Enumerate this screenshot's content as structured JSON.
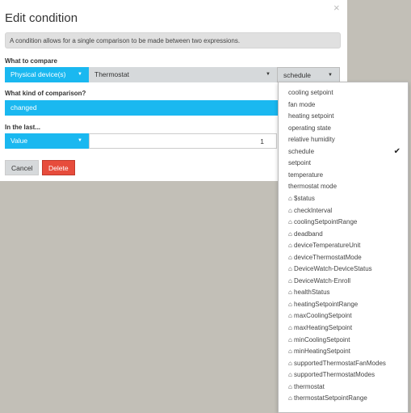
{
  "dialog": {
    "title": "Edit condition",
    "close_icon": "×",
    "info": "A condition allows for a single comparison to be made between two expressions.",
    "compare_label": "What to compare",
    "source": "Physical device(s)",
    "device": "Thermostat",
    "attribute": "schedule",
    "comparison_label": "What kind of comparison?",
    "comparison": "changed",
    "last_label": "In the last...",
    "last_type": "Value",
    "last_value": "1",
    "cancel": "Cancel",
    "delete": "Delete"
  },
  "colors": {
    "accent": "#1ab8f0",
    "delete": "#e74c3c"
  },
  "menu": {
    "selected": "schedule",
    "items": [
      "cooling setpoint",
      "fan mode",
      "heating setpoint",
      "operating state",
      "relative humidity",
      "schedule",
      "setpoint",
      "temperature",
      "thermostat mode",
      "⌂ $status",
      "⌂ checkInterval",
      "⌂ coolingSetpointRange",
      "⌂ deadband",
      "⌂ deviceTemperatureUnit",
      "⌂ deviceThermostatMode",
      "⌂ DeviceWatch-DeviceStatus",
      "⌂ DeviceWatch-Enroll",
      "⌂ healthStatus",
      "⌂ heatingSetpointRange",
      "⌂ maxCoolingSetpoint",
      "⌂ maxHeatingSetpoint",
      "⌂ minCoolingSetpoint",
      "⌂ minHeatingSetpoint",
      "⌂ supportedThermostatFanModes",
      "⌂ supportedThermostatModes",
      "⌂ thermostat",
      "⌂ thermostatSetpointRange"
    ]
  }
}
